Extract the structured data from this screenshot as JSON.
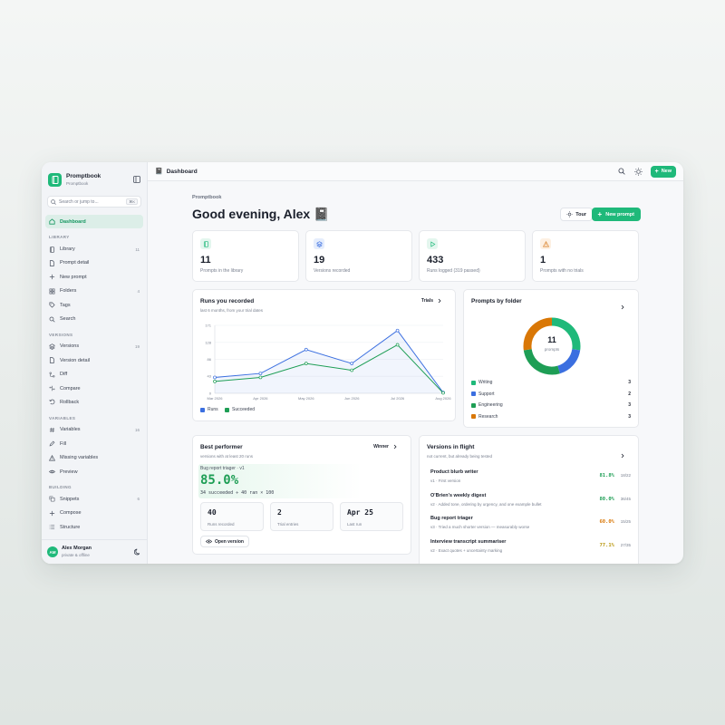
{
  "app": {
    "name": "Promptbook",
    "subtitle": "Promptbook"
  },
  "sidebar": {
    "search_placeholder": "Search or jump to...",
    "search_shortcut": "⌘K",
    "dashboard": "Dashboard",
    "sections": [
      {
        "title": "LIBRARY",
        "items": [
          {
            "label": "Library",
            "count": "11",
            "icon": "book-icon"
          },
          {
            "label": "Prompt detail",
            "count": "",
            "icon": "file-icon"
          },
          {
            "label": "New prompt",
            "count": "",
            "icon": "plus-icon"
          },
          {
            "label": "Folders",
            "count": "4",
            "icon": "grid-icon"
          },
          {
            "label": "Tags",
            "count": "",
            "icon": "tag-icon"
          },
          {
            "label": "Search",
            "count": "",
            "icon": "search-icon"
          }
        ]
      },
      {
        "title": "VERSIONS",
        "items": [
          {
            "label": "Versions",
            "count": "19",
            "icon": "layers-icon"
          },
          {
            "label": "Version detail",
            "count": "",
            "icon": "file-icon"
          },
          {
            "label": "Diff",
            "count": "",
            "icon": "diff-icon"
          },
          {
            "label": "Compare",
            "count": "",
            "icon": "compare-icon"
          },
          {
            "label": "Rollback",
            "count": "",
            "icon": "rollback-icon"
          }
        ]
      },
      {
        "title": "VARIABLES",
        "items": [
          {
            "label": "Variables",
            "count": "16",
            "icon": "hash-icon"
          },
          {
            "label": "Fill",
            "count": "",
            "icon": "pen-icon"
          },
          {
            "label": "Missing variables",
            "count": "",
            "icon": "warning-icon"
          },
          {
            "label": "Preview",
            "count": "",
            "icon": "eye-icon"
          }
        ]
      },
      {
        "title": "BUILDING",
        "items": [
          {
            "label": "Snippets",
            "count": "6",
            "icon": "copy-icon"
          },
          {
            "label": "Compose",
            "count": "",
            "icon": "plus-icon"
          },
          {
            "label": "Structure",
            "count": "",
            "icon": "list-icon"
          }
        ]
      }
    ],
    "user": {
      "initials": "AM",
      "name": "Alex Morgan",
      "status": "private & offline"
    }
  },
  "topbar": {
    "title": "Dashboard",
    "new_label": "New"
  },
  "header": {
    "eyebrow": "Promptbook",
    "greeting": "Good evening, Alex 📓",
    "tour": "Tour",
    "new_prompt": "New prompt"
  },
  "stats": [
    {
      "value": "11",
      "label": "Prompts in the library",
      "icon": "book-icon",
      "color": "#1fb97a",
      "bg": "#e3f6ee"
    },
    {
      "value": "19",
      "label": "Versions recorded",
      "icon": "layers-icon",
      "color": "#3b6fe0",
      "bg": "#e5edfc"
    },
    {
      "value": "433",
      "label": "Runs logged (319 passed)",
      "icon": "play-icon",
      "color": "#1fb97a",
      "bg": "#e3f6ee"
    },
    {
      "value": "1",
      "label": "Prompts with no trials",
      "icon": "warning-icon",
      "color": "#d9822b",
      "bg": "#fdf0e2"
    }
  ],
  "runs_card": {
    "title": "Runs you recorded",
    "subtitle": "last 6 months, from your trial dates",
    "link": "Trials"
  },
  "chart_data": {
    "type": "line",
    "x": [
      "Mar 2026",
      "Apr 2026",
      "May 2026",
      "Jun 2026",
      "Jul 2026",
      "Aug 2026"
    ],
    "yticks": [
      "0",
      "43",
      "86",
      "128",
      "171"
    ],
    "ylim": [
      0,
      171
    ],
    "series": [
      {
        "name": "Runs",
        "color": "#3b6fe0",
        "values": [
          40,
          50,
          110,
          75,
          158,
          2
        ]
      },
      {
        "name": "Succeeded",
        "color": "#1e9e55",
        "values": [
          30,
          40,
          75,
          58,
          122,
          1
        ]
      }
    ]
  },
  "folders_card": {
    "title": "Prompts by folder",
    "center_value": "11",
    "center_label": "prompts",
    "folders": [
      {
        "name": "Writing",
        "count": 3,
        "color": "#1fb97a"
      },
      {
        "name": "Support",
        "count": 2,
        "color": "#3b6fe0"
      },
      {
        "name": "Engineering",
        "count": 3,
        "color": "#1e9e55"
      },
      {
        "name": "Research",
        "count": 3,
        "color": "#d97706"
      }
    ]
  },
  "best": {
    "title": "Best performer",
    "subtitle": "versions with at least 20 runs",
    "link": "Winner",
    "name": "Bug report triager · v1",
    "percent": "85.0%",
    "detail": "34 succeeded ÷ 40 ran × 100",
    "minis": [
      {
        "value": "40",
        "label": "Runs recorded"
      },
      {
        "value": "2",
        "label": "Trial entries"
      },
      {
        "value": "Apr 25",
        "label": "Last run"
      }
    ],
    "open": "Open version"
  },
  "flight": {
    "title": "Versions in flight",
    "subtitle": "not current, but already being tested",
    "rows": [
      {
        "title": "Product blurb writer",
        "sub": "v1 · First version",
        "pct": "81.8%",
        "frac": "18/22",
        "color": "#1e9e55"
      },
      {
        "title": "O'Brien's weekly digest",
        "sub": "v2 · Added tone, ordering by urgency, and one example bullet",
        "pct": "80.0%",
        "frac": "36/45",
        "color": "#1e9e55"
      },
      {
        "title": "Bug report triager",
        "sub": "v3 · Tried a much shorter version — measurably worse",
        "pct": "60.0%",
        "frac": "15/25",
        "color": "#d97706"
      },
      {
        "title": "Interview transcript summariser",
        "sub": "v2 · Exact quotes + uncertainty marking",
        "pct": "77.1%",
        "frac": "27/35",
        "color": "#b7950b"
      }
    ]
  }
}
